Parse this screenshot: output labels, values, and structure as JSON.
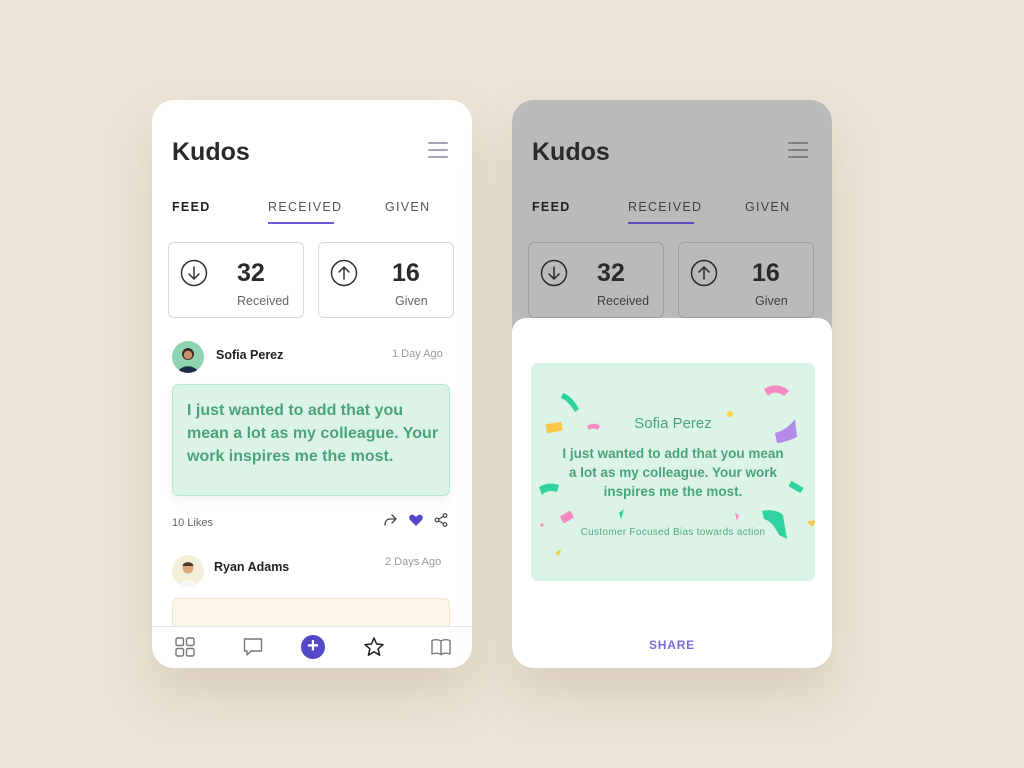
{
  "app": {
    "title": "Kudos"
  },
  "tabs": [
    {
      "label": "FEED",
      "active": true
    },
    {
      "label": "RECEIVED",
      "underlined": true
    },
    {
      "label": "GIVEN"
    }
  ],
  "stats": {
    "received": {
      "value": "32",
      "label": "Received",
      "icon": "arrow-down-circle-icon"
    },
    "given": {
      "value": "16",
      "label": "Given",
      "icon": "arrow-up-circle-icon"
    }
  },
  "feed": {
    "posts": [
      {
        "author": "Sofia Perez",
        "time": "1 Day Ago",
        "message": "I just wanted to add that you mean a lot as my colleague. Your work inspires me the most.",
        "likes": "10 Likes"
      },
      {
        "author": "Ryan Adams",
        "time": "2 Days Ago"
      }
    ]
  },
  "nav": {
    "items": [
      "grid-icon",
      "chat-icon",
      "plus-icon",
      "star-icon",
      "book-icon"
    ],
    "plus_symbol": "+"
  },
  "kudos_card": {
    "name": "Sofia Perez",
    "message": "I just wanted to add that you mean a lot as my colleague. Your work inspires me the most.",
    "tags": "Customer Focused Bias towards action",
    "share_label": "SHARE"
  },
  "colors": {
    "accent": "#5548c8",
    "card_green": "#dcf4e6",
    "text_green": "#4aa37a",
    "background": "#ebe4d7",
    "like_heart": "#5548c8"
  }
}
